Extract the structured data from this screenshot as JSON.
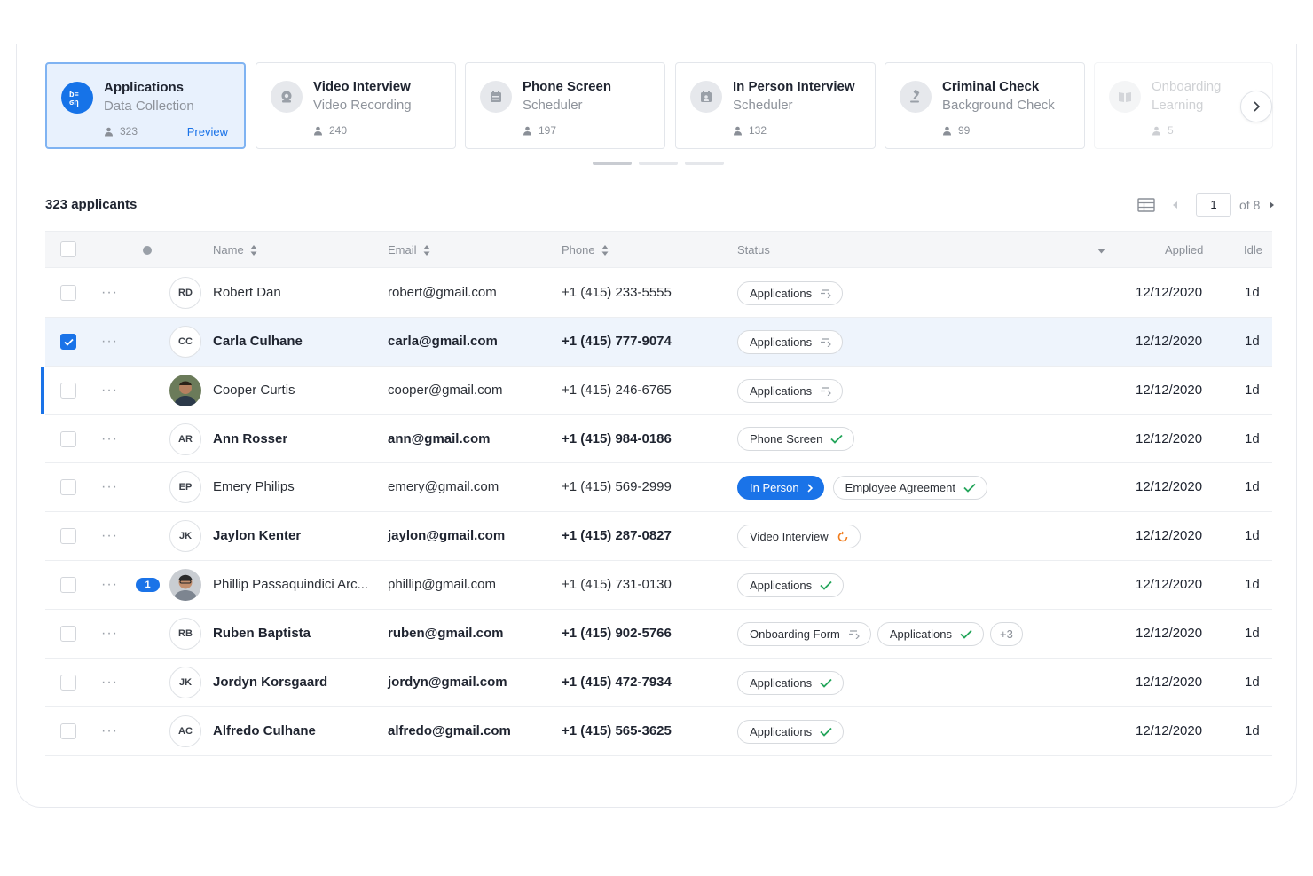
{
  "stages": [
    {
      "title": "Applications",
      "subtitle": "Data Collection",
      "count": "323",
      "action": "Preview",
      "icon": "form-icon"
    },
    {
      "title": "Video Interview",
      "subtitle": "Video Recording",
      "count": "240",
      "icon": "video-icon"
    },
    {
      "title": "Phone Screen",
      "subtitle": "Scheduler",
      "count": "197",
      "icon": "calendar-icon"
    },
    {
      "title": "In Person Interview",
      "subtitle": "Scheduler",
      "count": "132",
      "icon": "calendar-person-icon"
    },
    {
      "title": "Criminal Check",
      "subtitle": "Background Check",
      "count": "99",
      "icon": "gavel-icon"
    },
    {
      "title": "Onboarding",
      "subtitle": "Learning",
      "count": "5",
      "icon": "book-icon"
    }
  ],
  "summary": {
    "applicants_label": "323 applicants"
  },
  "pagination": {
    "current": "1",
    "of_label": "of 8"
  },
  "table": {
    "headers": {
      "name": "Name",
      "email": "Email",
      "phone": "Phone",
      "status": "Status",
      "applied": "Applied",
      "idle": "Idle"
    },
    "rows": [
      {
        "initials": "RD",
        "name": "Robert Dan",
        "email": "robert@gmail.com",
        "phone": "+1 (415) 233-5555",
        "statuses": [
          {
            "label": "Applications",
            "icon": "viewed-icon"
          }
        ],
        "applied": "12/12/2020",
        "idle": "1d"
      },
      {
        "initials": "CC",
        "name": "Carla Culhane",
        "email": "carla@gmail.com",
        "phone": "+1 (415) 777-9074",
        "statuses": [
          {
            "label": "Applications",
            "icon": "viewed-icon"
          }
        ],
        "applied": "12/12/2020",
        "idle": "1d"
      },
      {
        "initials": "",
        "name": "Cooper Curtis",
        "email": "cooper@gmail.com",
        "phone": "+1 (415) 246-6765",
        "statuses": [
          {
            "label": "Applications",
            "icon": "viewed-icon"
          }
        ],
        "applied": "12/12/2020",
        "idle": "1d"
      },
      {
        "initials": "AR",
        "name": "Ann Rosser",
        "email": "ann@gmail.com",
        "phone": "+1 (415) 984-0186",
        "statuses": [
          {
            "label": "Phone Screen",
            "icon": "check-icon"
          }
        ],
        "applied": "12/12/2020",
        "idle": "1d"
      },
      {
        "initials": "EP",
        "name": "Emery Philips",
        "email": "emery@gmail.com",
        "phone": "+1 (415) 569-2999",
        "statuses": [
          {
            "label": "In Person",
            "icon": "chevron-right-icon"
          },
          {
            "label": "Employee Agreement",
            "icon": "check-icon"
          }
        ],
        "applied": "12/12/2020",
        "idle": "1d"
      },
      {
        "initials": "JK",
        "name": "Jaylon Kenter",
        "email": "jaylon@gmail.com",
        "phone": "+1 (415) 287-0827",
        "statuses": [
          {
            "label": "Video Interview",
            "icon": "pending-icon"
          }
        ],
        "applied": "12/12/2020",
        "idle": "1d"
      },
      {
        "initials": "",
        "badge": "1",
        "name": "Phillip Passaquindici Arc...",
        "email": "phillip@gmail.com",
        "phone": "+1 (415) 731-0130",
        "statuses": [
          {
            "label": "Applications",
            "icon": "check-icon"
          }
        ],
        "applied": "12/12/2020",
        "idle": "1d"
      },
      {
        "initials": "RB",
        "name": "Ruben Baptista",
        "email": "ruben@gmail.com",
        "phone": "+1 (415) 902-5766",
        "statuses": [
          {
            "label": "Onboarding Form",
            "icon": "viewed-icon"
          },
          {
            "label": "Applications",
            "icon": "check-icon"
          },
          {
            "label": "+3",
            "icon": ""
          }
        ],
        "applied": "12/12/2020",
        "idle": "1d"
      },
      {
        "initials": "JK",
        "name": "Jordyn Korsgaard",
        "email": "jordyn@gmail.com",
        "phone": "+1 (415) 472-7934",
        "statuses": [
          {
            "label": "Applications",
            "icon": "check-icon"
          }
        ],
        "applied": "12/12/2020",
        "idle": "1d"
      },
      {
        "initials": "AC",
        "name": "Alfredo Culhane",
        "email": "alfredo@gmail.com",
        "phone": "+1 (415) 565-3625",
        "statuses": [
          {
            "label": "Applications",
            "icon": "check-icon"
          }
        ],
        "applied": "12/12/2020",
        "idle": "1d"
      }
    ]
  },
  "colors": {
    "accent": "#1a73e8",
    "check": "#23a55a",
    "pending": "#f07c1d"
  }
}
